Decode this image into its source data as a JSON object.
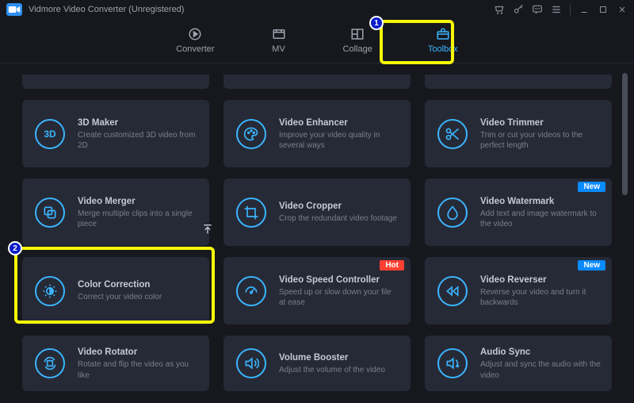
{
  "window": {
    "title": "Vidmore Video Converter (Unregistered)"
  },
  "nav": {
    "items": [
      {
        "label": "Converter"
      },
      {
        "label": "MV"
      },
      {
        "label": "Collage"
      },
      {
        "label": "Toolbox"
      }
    ],
    "active_index": 3
  },
  "badges": {
    "new": "New",
    "hot": "Hot"
  },
  "tools": [
    {
      "title": "3D Maker",
      "desc": "Create customized 3D video from 2D",
      "icon": "3d",
      "badge": null
    },
    {
      "title": "Video Enhancer",
      "desc": "Improve your video quality in several ways",
      "icon": "palette",
      "badge": null
    },
    {
      "title": "Video Trimmer",
      "desc": "Trim or cut your videos to the perfect length",
      "icon": "scissors",
      "badge": null
    },
    {
      "title": "Video Merger",
      "desc": "Merge multiple clips into a single piece",
      "icon": "merge",
      "badge": null
    },
    {
      "title": "Video Cropper",
      "desc": "Crop the redundant video footage",
      "icon": "crop",
      "badge": null
    },
    {
      "title": "Video Watermark",
      "desc": "Add text and image watermark to the video",
      "icon": "watermark",
      "badge": "new"
    },
    {
      "title": "Color Correction",
      "desc": "Correct your video color",
      "icon": "color",
      "badge": null
    },
    {
      "title": "Video Speed Controller",
      "desc": "Speed up or slow down your file at ease",
      "icon": "speed",
      "badge": "hot"
    },
    {
      "title": "Video Reverser",
      "desc": "Reverse your video and turn it backwards",
      "icon": "reverse",
      "badge": "new"
    },
    {
      "title": "Video Rotator",
      "desc": "Rotate and flip the video as you like",
      "icon": "rotate",
      "badge": null
    },
    {
      "title": "Volume Booster",
      "desc": "Adjust the volume of the video",
      "icon": "volume",
      "badge": null
    },
    {
      "title": "Audio Sync",
      "desc": "Adjust and sync the audio with the video",
      "icon": "sync",
      "badge": null
    }
  ],
  "callouts": {
    "step1": "1",
    "step2": "2"
  }
}
